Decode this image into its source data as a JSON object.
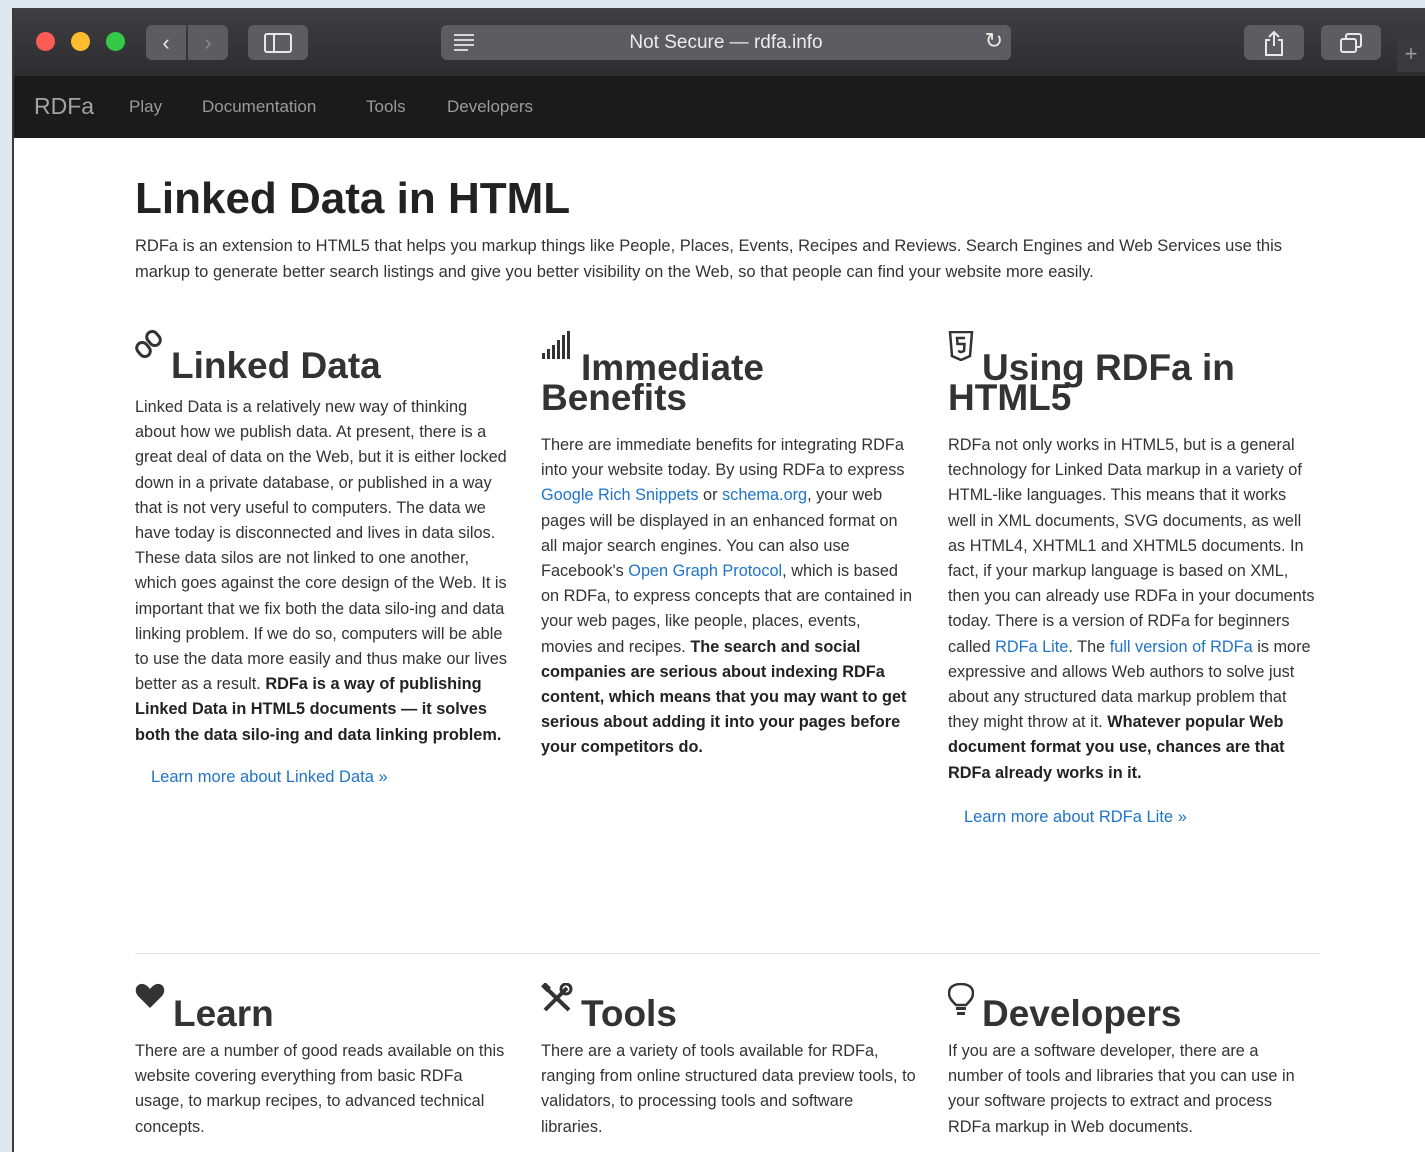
{
  "browser": {
    "url_text": "Not Secure — rdfa.info",
    "back_glyph": "‹",
    "forward_glyph": "›",
    "reload_glyph": "↻",
    "new_tab_glyph": "+"
  },
  "site_nav": {
    "brand": "RDFa",
    "links": [
      "Play",
      "Documentation",
      "Tools",
      "Developers"
    ]
  },
  "hero": {
    "title": "Linked Data in HTML",
    "intro": "RDFa is an extension to HTML5 that helps you markup things like People, Places, Events, Recipes and Reviews. Search Engines and Web Services use this markup to generate better search listings and give you better visibility on the Web, so that people can find your website more easily."
  },
  "sections": {
    "linked_data": {
      "icon": "link-icon",
      "title": "Linked Data",
      "body": "Linked Data is a relatively new way of thinking about how we publish data. At present, there is a great deal of data on the Web, but it is either locked down in a private database, or published in a way that is not very useful to computers. The data we have today is disconnected and lives in data silos. These data silos are not linked to one another, which goes against the core design of the Web. It is important that we fix both the data silo-ing and data linking problem. If we do so, computers will be able to use the data more easily and thus make our lives better as a result.",
      "body_bold": "RDFa is a way of publishing Linked Data in HTML5 documents — it solves both the data silo-ing and data linking problem.",
      "link": "Learn more about Linked Data »"
    },
    "benefits": {
      "icon": "signal-bars-icon",
      "title_line1": "Immediate",
      "title_line2": "Benefits",
      "p1": "There are immediate benefits for integrating RDFa into your website today. By using RDFa to express",
      "link1": "Google Rich Snippets",
      "p2": "or",
      "link2": "schema.org",
      "p3": ", your web pages will be displayed in an enhanced format on all major search engines. You can also use Facebook's",
      "link3": "Open Graph Protocol",
      "p4": ", which is based on RDFa, to express concepts that are contained in your web pages, like people, places, events, movies and recipes.",
      "bold": "The search and social companies are serious about indexing RDFa content, which means that you may want to get serious about adding it into your pages before your competitors do."
    },
    "html5": {
      "icon": "html5-shield-icon",
      "title_line1": "Using RDFa in",
      "title_line2": "HTML5",
      "p1": "RDFa not only works in HTML5, but is a general technology for Linked Data markup in a variety of HTML-like languages. This means that it works well in XML documents, SVG documents, as well as HTML4, XHTML1 and XHTML5 documents. In fact, if your markup language is based on XML, then you can already use RDFa in your documents today. There is a version of RDFa for beginners called",
      "link1": "RDFa Lite",
      "p2": ". The",
      "link2": "full version of RDFa",
      "p3": "is more expressive and allows Web authors to solve just about any structured data markup problem that they might throw at it.",
      "bold": "Whatever popular Web document format you use, chances are that RDFa already works in it.",
      "link": "Learn more about RDFa Lite »"
    },
    "learn": {
      "icon": "heart-icon",
      "title": "Learn",
      "body": "There are a number of good reads available on this website covering everything from basic RDFa usage, to markup recipes, to advanced technical concepts."
    },
    "tools": {
      "icon": "wrench-screwdriver-icon",
      "title": "Tools",
      "body": "There are a variety of tools available for RDFa, ranging from online structured data preview tools, to validators, to processing tools and software libraries."
    },
    "developers": {
      "icon": "lightbulb-icon",
      "title": "Developers",
      "body": "If you are a software developer, there are a number of tools and libraries that you can use in your software projects to extract and process RDFa markup in Web documents."
    }
  },
  "colors": {
    "link": "#1f74c8",
    "navbar": "#1b1b1b",
    "toolbar": "#3a3a3d"
  }
}
